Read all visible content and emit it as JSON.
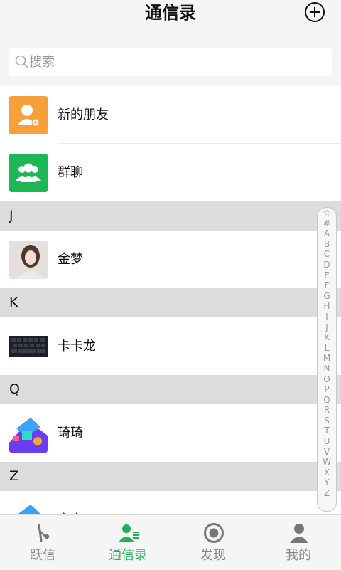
{
  "header": {
    "title": "通信录"
  },
  "search": {
    "placeholder": "搜索"
  },
  "top_items": [
    {
      "label": "新的朋友",
      "icon": "new-friend-icon",
      "color": "#f6a03a"
    },
    {
      "label": "群聊",
      "icon": "group-chat-icon",
      "color": "#1db755"
    }
  ],
  "sections": [
    {
      "letter": "J",
      "contacts": [
        {
          "name": "金梦"
        }
      ]
    },
    {
      "letter": "K",
      "contacts": [
        {
          "name": "卡卡龙"
        }
      ]
    },
    {
      "letter": "Q",
      "contacts": [
        {
          "name": "琦琦"
        }
      ]
    },
    {
      "letter": "Z",
      "contacts": [
        {
          "name": "宝全"
        }
      ]
    }
  ],
  "index_letters": [
    "☆",
    "#",
    "A",
    "B",
    "C",
    "D",
    "E",
    "F",
    "G",
    "H",
    "I",
    "J",
    "K",
    "L",
    "M",
    "N",
    "O",
    "P",
    "Q",
    "R",
    "S",
    "T",
    "U",
    "V",
    "W",
    "X",
    "Y",
    "Z"
  ],
  "tabs": [
    {
      "label": "跃信",
      "icon": "pin-icon",
      "active": false
    },
    {
      "label": "通信录",
      "icon": "contacts-icon",
      "active": true
    },
    {
      "label": "发现",
      "icon": "discover-icon",
      "active": false
    },
    {
      "label": "我的",
      "icon": "profile-icon",
      "active": false
    }
  ],
  "colors": {
    "accent": "#1fb155",
    "inactive": "#888888"
  }
}
